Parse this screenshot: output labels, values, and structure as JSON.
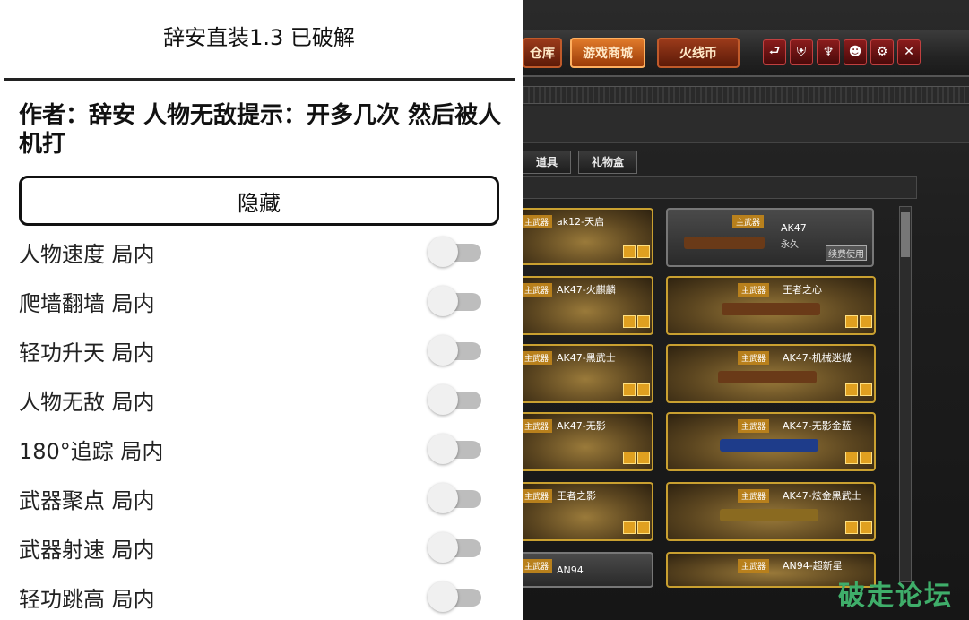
{
  "panel": {
    "title": "辞安直装1.3  已破解",
    "author_note": "作者：辞安 人物无敌提示：开多几次 然后被人机打",
    "hide_button": "隐藏",
    "toggles": [
      {
        "label": "人物速度 局内",
        "on": false
      },
      {
        "label": "爬墙翻墙 局内",
        "on": false
      },
      {
        "label": "轻功升天 局内",
        "on": false
      },
      {
        "label": "人物无敌 局内",
        "on": false
      },
      {
        "label": "180°追踪 局内",
        "on": false
      },
      {
        "label": "武器聚点 局内",
        "on": false
      },
      {
        "label": "武器射速 局内",
        "on": false
      },
      {
        "label": "轻功跳高 局内",
        "on": false
      }
    ]
  },
  "game": {
    "tabs": [
      "仓库",
      "游戏商城",
      "火线币"
    ],
    "icons": [
      "back-icon",
      "shield-icon",
      "trophy-icon",
      "user-icon",
      "settings-icon",
      "close-icon"
    ],
    "subtabs": [
      "道具",
      "礼物盒"
    ],
    "cards": [
      {
        "tag": "主武器",
        "name": "ak12-天启",
        "sub": ""
      },
      {
        "tag": "主武器",
        "name": "AK47",
        "sub": "永久",
        "action": "续费使用"
      },
      {
        "tag": "主武器",
        "name": "AK47-火麒麟",
        "sub": ""
      },
      {
        "tag": "主武器",
        "name": "王者之心",
        "sub": ""
      },
      {
        "tag": "主武器",
        "name": "AK47-黑武士",
        "sub": ""
      },
      {
        "tag": "主武器",
        "name": "AK47-机械迷城",
        "sub": ""
      },
      {
        "tag": "主武器",
        "name": "AK47-无影",
        "sub": ""
      },
      {
        "tag": "主武器",
        "name": "AK47-无影金蓝",
        "sub": ""
      },
      {
        "tag": "主武器",
        "name": "王者之影",
        "sub": ""
      },
      {
        "tag": "主武器",
        "name": "AK47-炫金黑武士",
        "sub": ""
      },
      {
        "tag": "主武器",
        "name": "AN94",
        "sub": ""
      },
      {
        "tag": "主武器",
        "name": "AN94-超新星",
        "sub": ""
      }
    ],
    "watermark": "破走论坛"
  }
}
